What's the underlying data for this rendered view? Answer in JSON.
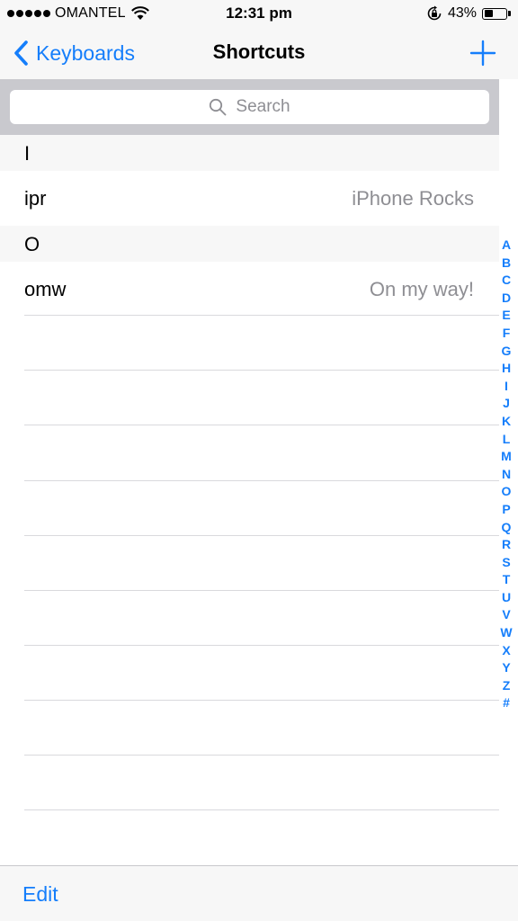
{
  "status_bar": {
    "carrier": "OMANTEL",
    "time": "12:31 pm",
    "battery_percent": "43%",
    "battery_level": 0.43,
    "signal_bars": 5,
    "icons": [
      "signal-dots-icon",
      "wifi-icon",
      "rotation-lock-icon",
      "battery-icon"
    ]
  },
  "nav": {
    "back_label": "Keyboards",
    "title": "Shortcuts",
    "add_icon": "plus-icon"
  },
  "search": {
    "placeholder": "Search"
  },
  "sections": [
    {
      "header": "I",
      "rows": [
        {
          "phrase": "iPhone Rocks",
          "shortcut": "ipr"
        }
      ]
    },
    {
      "header": "O",
      "rows": [
        {
          "phrase": "On my way!",
          "shortcut": "omw"
        }
      ]
    }
  ],
  "index": [
    "A",
    "B",
    "C",
    "D",
    "E",
    "F",
    "G",
    "H",
    "I",
    "J",
    "K",
    "L",
    "M",
    "N",
    "O",
    "P",
    "Q",
    "R",
    "S",
    "T",
    "U",
    "V",
    "W",
    "X",
    "Y",
    "Z",
    "#"
  ],
  "toolbar": {
    "edit_label": "Edit"
  },
  "colors": {
    "accent": "#157efb",
    "secondary_text": "#8e8e93",
    "bar_background": "#f7f7f7",
    "search_background": "#c9c9ce"
  }
}
